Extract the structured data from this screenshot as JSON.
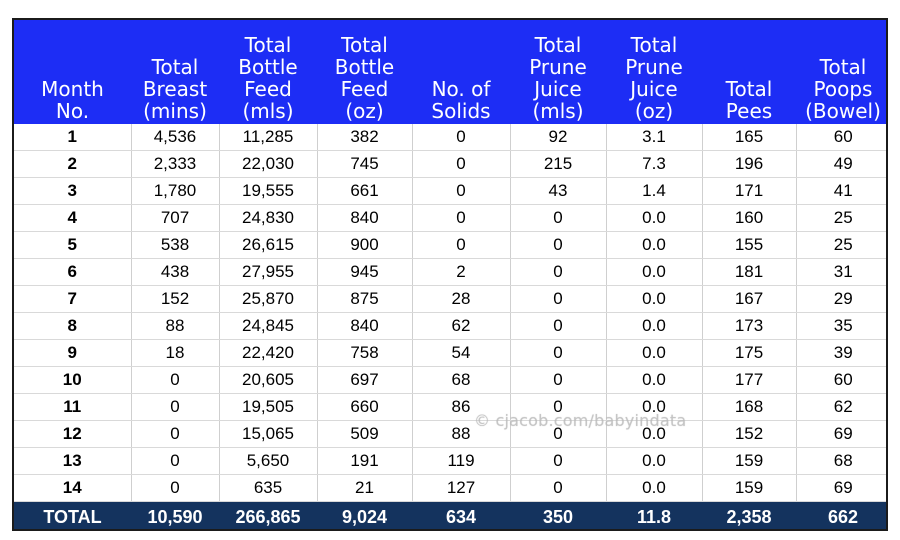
{
  "chart_data": {
    "type": "table",
    "headers": [
      [
        "Month",
        "No."
      ],
      [
        "Total",
        "Breast",
        "(mins)"
      ],
      [
        "Total",
        "Bottle",
        "Feed",
        "(mls)"
      ],
      [
        "Total",
        "Bottle",
        "Feed",
        "(oz)"
      ],
      [
        "No. of",
        "Solids"
      ],
      [
        "Total",
        "Prune",
        "Juice",
        "(mls)"
      ],
      [
        "Total",
        "Prune",
        "Juice",
        "(oz)"
      ],
      [
        "Total",
        "Pees"
      ],
      [
        "Total",
        "Poops",
        "(Bowel)"
      ]
    ],
    "rows": [
      [
        "1",
        "4,536",
        "11,285",
        "382",
        "0",
        "92",
        "3.1",
        "165",
        "60"
      ],
      [
        "2",
        "2,333",
        "22,030",
        "745",
        "0",
        "215",
        "7.3",
        "196",
        "49"
      ],
      [
        "3",
        "1,780",
        "19,555",
        "661",
        "0",
        "43",
        "1.4",
        "171",
        "41"
      ],
      [
        "4",
        "707",
        "24,830",
        "840",
        "0",
        "0",
        "0.0",
        "160",
        "25"
      ],
      [
        "5",
        "538",
        "26,615",
        "900",
        "0",
        "0",
        "0.0",
        "155",
        "25"
      ],
      [
        "6",
        "438",
        "27,955",
        "945",
        "2",
        "0",
        "0.0",
        "181",
        "31"
      ],
      [
        "7",
        "152",
        "25,870",
        "875",
        "28",
        "0",
        "0.0",
        "167",
        "29"
      ],
      [
        "8",
        "88",
        "24,845",
        "840",
        "62",
        "0",
        "0.0",
        "173",
        "35"
      ],
      [
        "9",
        "18",
        "22,420",
        "758",
        "54",
        "0",
        "0.0",
        "175",
        "39"
      ],
      [
        "10",
        "0",
        "20,605",
        "697",
        "68",
        "0",
        "0.0",
        "177",
        "60"
      ],
      [
        "11",
        "0",
        "19,505",
        "660",
        "86",
        "0",
        "0.0",
        "168",
        "62"
      ],
      [
        "12",
        "0",
        "15,065",
        "509",
        "88",
        "0",
        "0.0",
        "152",
        "69"
      ],
      [
        "13",
        "0",
        "5,650",
        "191",
        "119",
        "0",
        "0.0",
        "159",
        "68"
      ],
      [
        "14",
        "0",
        "635",
        "21",
        "127",
        "0",
        "0.0",
        "159",
        "69"
      ]
    ],
    "totals": [
      "TOTAL",
      "10,590",
      "266,865",
      "9,024",
      "634",
      "350",
      "11.8",
      "2,358",
      "662"
    ]
  },
  "watermark": "© cjacob.com/babyindata",
  "colors": {
    "header_bg": "#1d2df5",
    "total_bg": "#14335e",
    "header_text": "#ffffff"
  }
}
